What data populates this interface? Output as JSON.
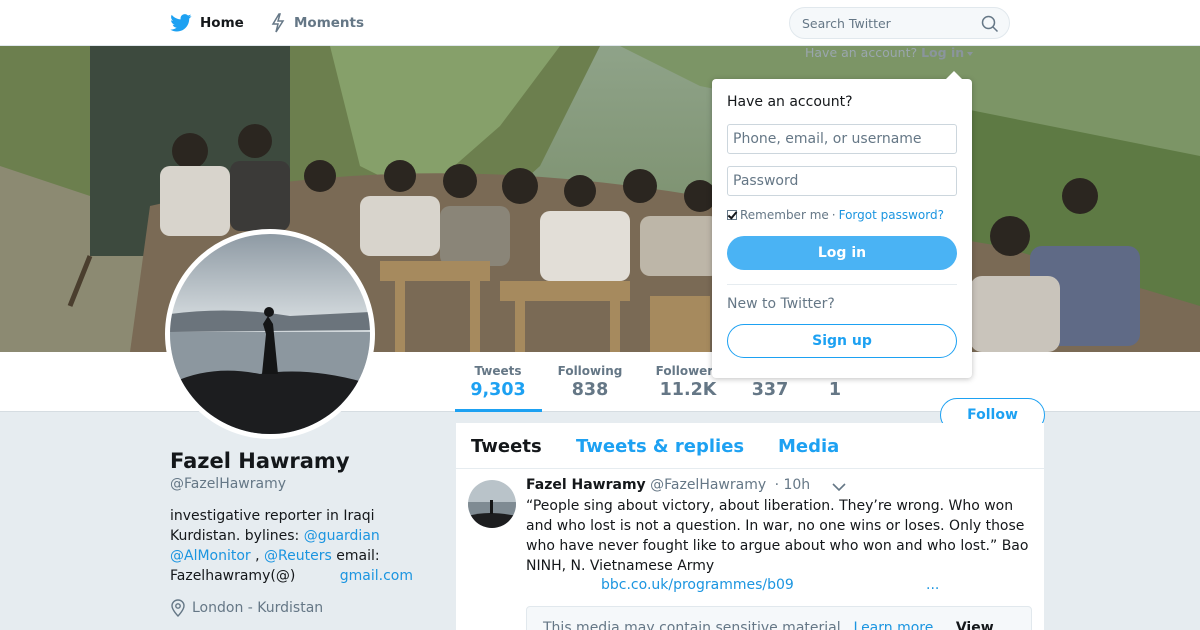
{
  "nav": {
    "home_label": "Home",
    "moments_label": "Moments",
    "search_placeholder": "Search Twitter",
    "login_hint_prefix": "Have an account?",
    "login_hint_link": "Log in"
  },
  "stats": [
    {
      "label": "Tweets",
      "value": "9,303",
      "active": true
    },
    {
      "label": "Following",
      "value": "838"
    },
    {
      "label": "Followers",
      "value": "11.2K"
    },
    {
      "label": "",
      "value": "337"
    },
    {
      "label": "",
      "value": "1"
    }
  ],
  "follow_label": "Follow",
  "profile": {
    "name": "Fazel Hawramy",
    "handle": "@FazelHawramy",
    "bio_text_1": "investigative reporter in Iraqi Kurdistan. bylines: ",
    "bio_link_1": "@guardian",
    "bio_link_2": "@AlMonitor",
    "bio_text_2": " , ",
    "bio_link_3": "@Reuters",
    "bio_text_3": " email: Fazelhawramy(@)",
    "bio_link_4": "gmail.com",
    "location": "London - Kurdistan"
  },
  "timeline": {
    "tabs": [
      "Tweets",
      "Tweets & replies",
      "Media"
    ],
    "tweet": {
      "name": "Fazel Hawramy",
      "handle": "@FazelHawramy",
      "time": "· 10h",
      "text": "“People sing about victory, about liberation. They’re wrong. Who won and who lost is not a question. In war, no one wins or loses. Only those who have never fought like to argue about who won and who lost.” Bao NINH, N. Vietnamese Army",
      "link": "bbc.co.uk/programmes/b09",
      "more": "...",
      "media_warning": "This media may contain sensitive material.",
      "learn_more": "Learn more",
      "view": "View"
    }
  },
  "login_dropdown": {
    "title": "Have an account?",
    "user_placeholder": "Phone, email, or username",
    "password_placeholder": "Password",
    "remember": "Remember me",
    "separator": " · ",
    "forgot": "Forgot password?",
    "login_button": "Log in",
    "new_prompt": "New to Twitter?",
    "signup_button": "Sign up"
  },
  "colors": {
    "accent": "#1da1f2",
    "link": "#1b95e0",
    "background": "#e6ecf0"
  }
}
